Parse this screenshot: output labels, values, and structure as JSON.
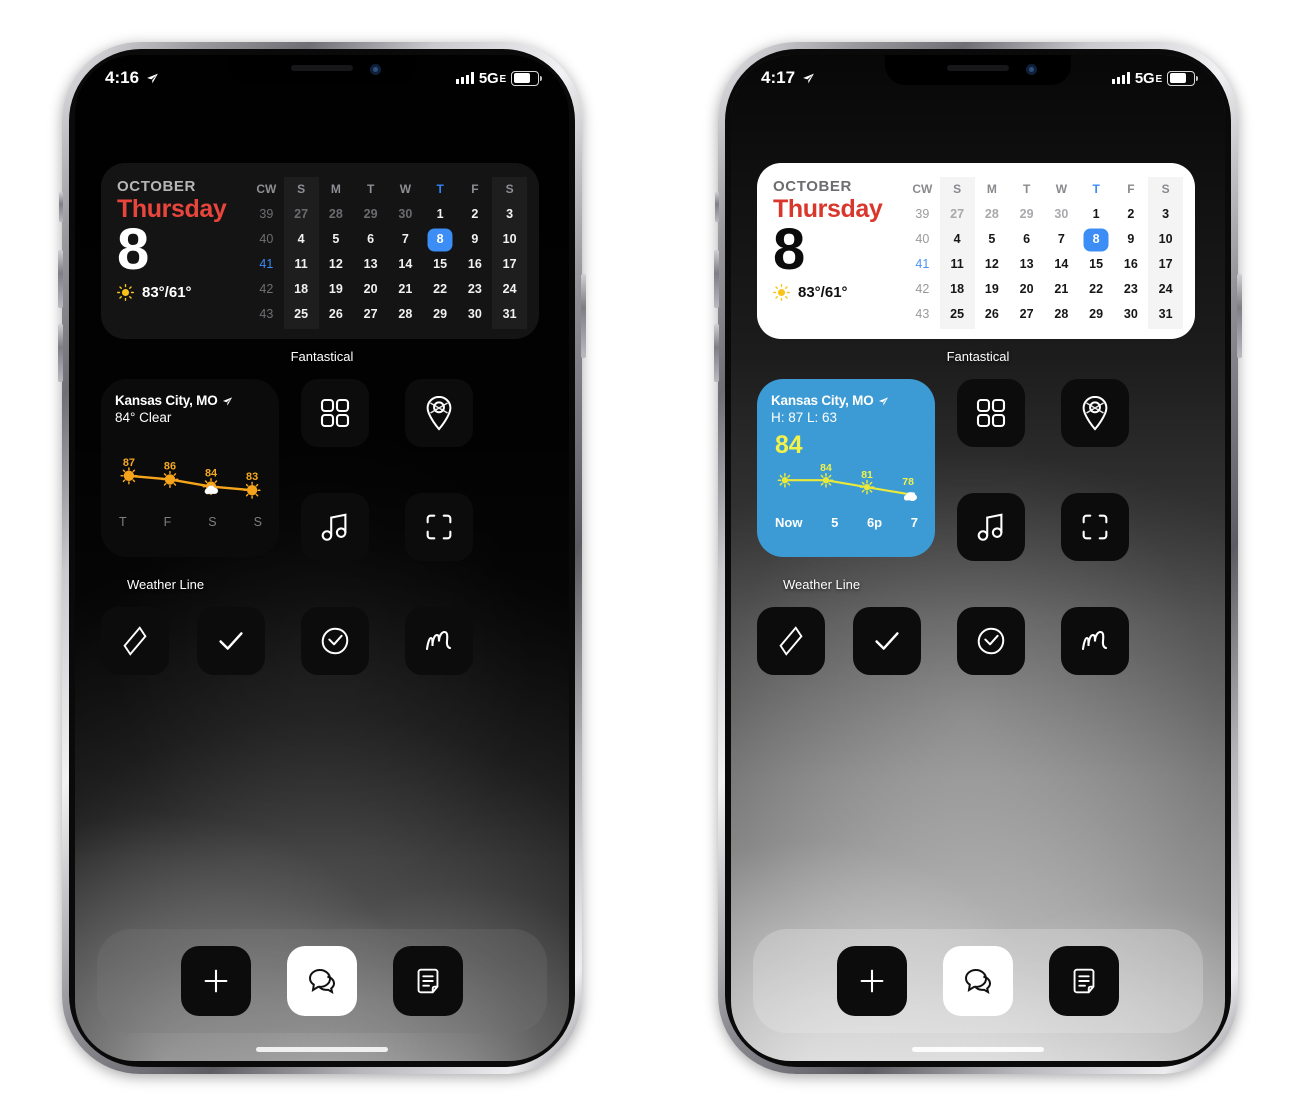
{
  "phones": [
    {
      "id": "left",
      "theme": "dark",
      "status": {
        "time": "4:16",
        "location_icon": "location-arrow-icon",
        "signal_icon": "cellular-bars-icon",
        "network": "5G",
        "network_sub": "E",
        "battery_icon": "battery-icon"
      },
      "calendar_widget": {
        "app_label": "Fantastical",
        "month": "OCTOBER",
        "weekday": "Thursday",
        "day": "8",
        "weather_icon": "sun-icon",
        "weather_temps": "83°/61°",
        "headers": [
          "CW",
          "S",
          "M",
          "T",
          "W",
          "T",
          "F",
          "S"
        ],
        "today_header_index": 5,
        "weeks": [
          {
            "cw": "39",
            "days": [
              "27",
              "28",
              "29",
              "30",
              "1",
              "2",
              "3"
            ],
            "muted": [
              true,
              true,
              true,
              true,
              false,
              false,
              false
            ]
          },
          {
            "cw": "40",
            "days": [
              "4",
              "5",
              "6",
              "7",
              "8",
              "9",
              "10"
            ],
            "muted": [
              false,
              false,
              false,
              false,
              false,
              false,
              false
            ],
            "selected": 4
          },
          {
            "cw": "41",
            "days": [
              "11",
              "12",
              "13",
              "14",
              "15",
              "16",
              "17"
            ],
            "muted": [
              false,
              false,
              false,
              false,
              false,
              false,
              false
            ],
            "cw_active": true
          },
          {
            "cw": "42",
            "days": [
              "18",
              "19",
              "20",
              "21",
              "22",
              "23",
              "24"
            ],
            "muted": [
              false,
              false,
              false,
              false,
              false,
              false,
              false
            ]
          },
          {
            "cw": "43",
            "days": [
              "25",
              "26",
              "27",
              "28",
              "29",
              "30",
              "31"
            ],
            "muted": [
              false,
              false,
              false,
              false,
              false,
              false,
              false
            ]
          }
        ]
      },
      "weather_widget": {
        "app_label": "Weather Line",
        "style": "dark",
        "city": "Kansas City, MO",
        "location_icon": "location-arrow-icon",
        "subtitle": "84° Clear",
        "big_temp": null,
        "axis_labels": [
          "T",
          "F",
          "S",
          "S"
        ],
        "chart_data": {
          "type": "line",
          "title": "Weather Line 4-day forecast",
          "categories": [
            "T",
            "F",
            "S",
            "S"
          ],
          "values": [
            87,
            86,
            84,
            83
          ],
          "point_icons": [
            "sun-icon",
            "sun-icon",
            "sun-cloud-icon",
            "sun-icon"
          ],
          "line_color": "#f6a41c",
          "label_color": "#f4a723",
          "ylim": [
            80,
            90
          ],
          "grid": false,
          "legend": "none"
        }
      },
      "app_icons_top": [
        {
          "name": "grid-icon",
          "row": 0,
          "col": 1
        },
        {
          "name": "maps-pin-icon",
          "row": 0,
          "col": 2
        },
        {
          "name": "music-note-icon",
          "row": 1,
          "col": 1
        },
        {
          "name": "scan-frame-icon",
          "row": 1,
          "col": 2
        }
      ],
      "app_icons_bottom": [
        {
          "name": "diamond-outline-icon"
        },
        {
          "name": "checkmark-icon"
        },
        {
          "name": "circle-check-icon"
        },
        {
          "name": "cursive-n-icon"
        }
      ],
      "dock": [
        {
          "name": "plus-icon",
          "style": "dark"
        },
        {
          "name": "chat-bubbles-icon",
          "style": "white"
        },
        {
          "name": "note-document-icon",
          "style": "dark"
        }
      ]
    },
    {
      "id": "right",
      "theme": "light",
      "status": {
        "time": "4:17",
        "location_icon": "location-arrow-icon",
        "signal_icon": "cellular-bars-icon",
        "network": "5G",
        "network_sub": "E",
        "battery_icon": "battery-icon"
      },
      "calendar_widget": {
        "app_label": "Fantastical",
        "month": "OCTOBER",
        "weekday": "Thursday",
        "day": "8",
        "weather_icon": "sun-icon",
        "weather_temps": "83°/61°",
        "headers": [
          "CW",
          "S",
          "M",
          "T",
          "W",
          "T",
          "F",
          "S"
        ],
        "today_header_index": 5,
        "weeks": [
          {
            "cw": "39",
            "days": [
              "27",
              "28",
              "29",
              "30",
              "1",
              "2",
              "3"
            ],
            "muted": [
              true,
              true,
              true,
              true,
              false,
              false,
              false
            ]
          },
          {
            "cw": "40",
            "days": [
              "4",
              "5",
              "6",
              "7",
              "8",
              "9",
              "10"
            ],
            "muted": [
              false,
              false,
              false,
              false,
              false,
              false,
              false
            ],
            "selected": 4
          },
          {
            "cw": "41",
            "days": [
              "11",
              "12",
              "13",
              "14",
              "15",
              "16",
              "17"
            ],
            "muted": [
              false,
              false,
              false,
              false,
              false,
              false,
              false
            ],
            "cw_active": true
          },
          {
            "cw": "42",
            "days": [
              "18",
              "19",
              "20",
              "21",
              "22",
              "23",
              "24"
            ],
            "muted": [
              false,
              false,
              false,
              false,
              false,
              false,
              false
            ]
          },
          {
            "cw": "43",
            "days": [
              "25",
              "26",
              "27",
              "28",
              "29",
              "30",
              "31"
            ],
            "muted": [
              false,
              false,
              false,
              false,
              false,
              false,
              false
            ]
          }
        ]
      },
      "weather_widget": {
        "app_label": "Weather Line",
        "style": "blue",
        "city": "Kansas City, MO",
        "location_icon": "location-arrow-icon",
        "subtitle": "H: 87 L: 63",
        "big_temp": "84",
        "axis_labels": [
          "Now",
          "5",
          "6p",
          "7"
        ],
        "chart_data": {
          "type": "line",
          "title": "Weather Line hourly forecast",
          "categories": [
            "Now",
            "5",
            "6p",
            "7"
          ],
          "values": [
            84,
            84,
            81,
            78
          ],
          "point_icons": [
            "sun-icon",
            "sun-icon",
            "sun-icon",
            "moon-cloud-icon"
          ],
          "line_color": "#e9e93a",
          "label_color": "#f2f24a",
          "ylim": [
            75,
            88
          ],
          "grid": false,
          "legend": "none"
        }
      },
      "app_icons_top": [
        {
          "name": "grid-icon",
          "row": 0,
          "col": 1
        },
        {
          "name": "maps-pin-icon",
          "row": 0,
          "col": 2
        },
        {
          "name": "music-note-icon",
          "row": 1,
          "col": 1
        },
        {
          "name": "scan-frame-icon",
          "row": 1,
          "col": 2
        }
      ],
      "app_icons_bottom": [
        {
          "name": "diamond-outline-icon"
        },
        {
          "name": "checkmark-icon"
        },
        {
          "name": "circle-check-icon"
        },
        {
          "name": "cursive-n-icon"
        }
      ],
      "dock": [
        {
          "name": "plus-icon",
          "style": "dark"
        },
        {
          "name": "chat-bubbles-icon",
          "style": "white"
        },
        {
          "name": "note-document-icon",
          "style": "dark"
        }
      ]
    }
  ],
  "colors": {
    "accent_blue": "#3c8df6",
    "weekday_red": "#e8453c",
    "widget_blue_bg": "#3c9bd4",
    "orange_line": "#f6a41c",
    "yellow_line": "#e9e93a"
  }
}
